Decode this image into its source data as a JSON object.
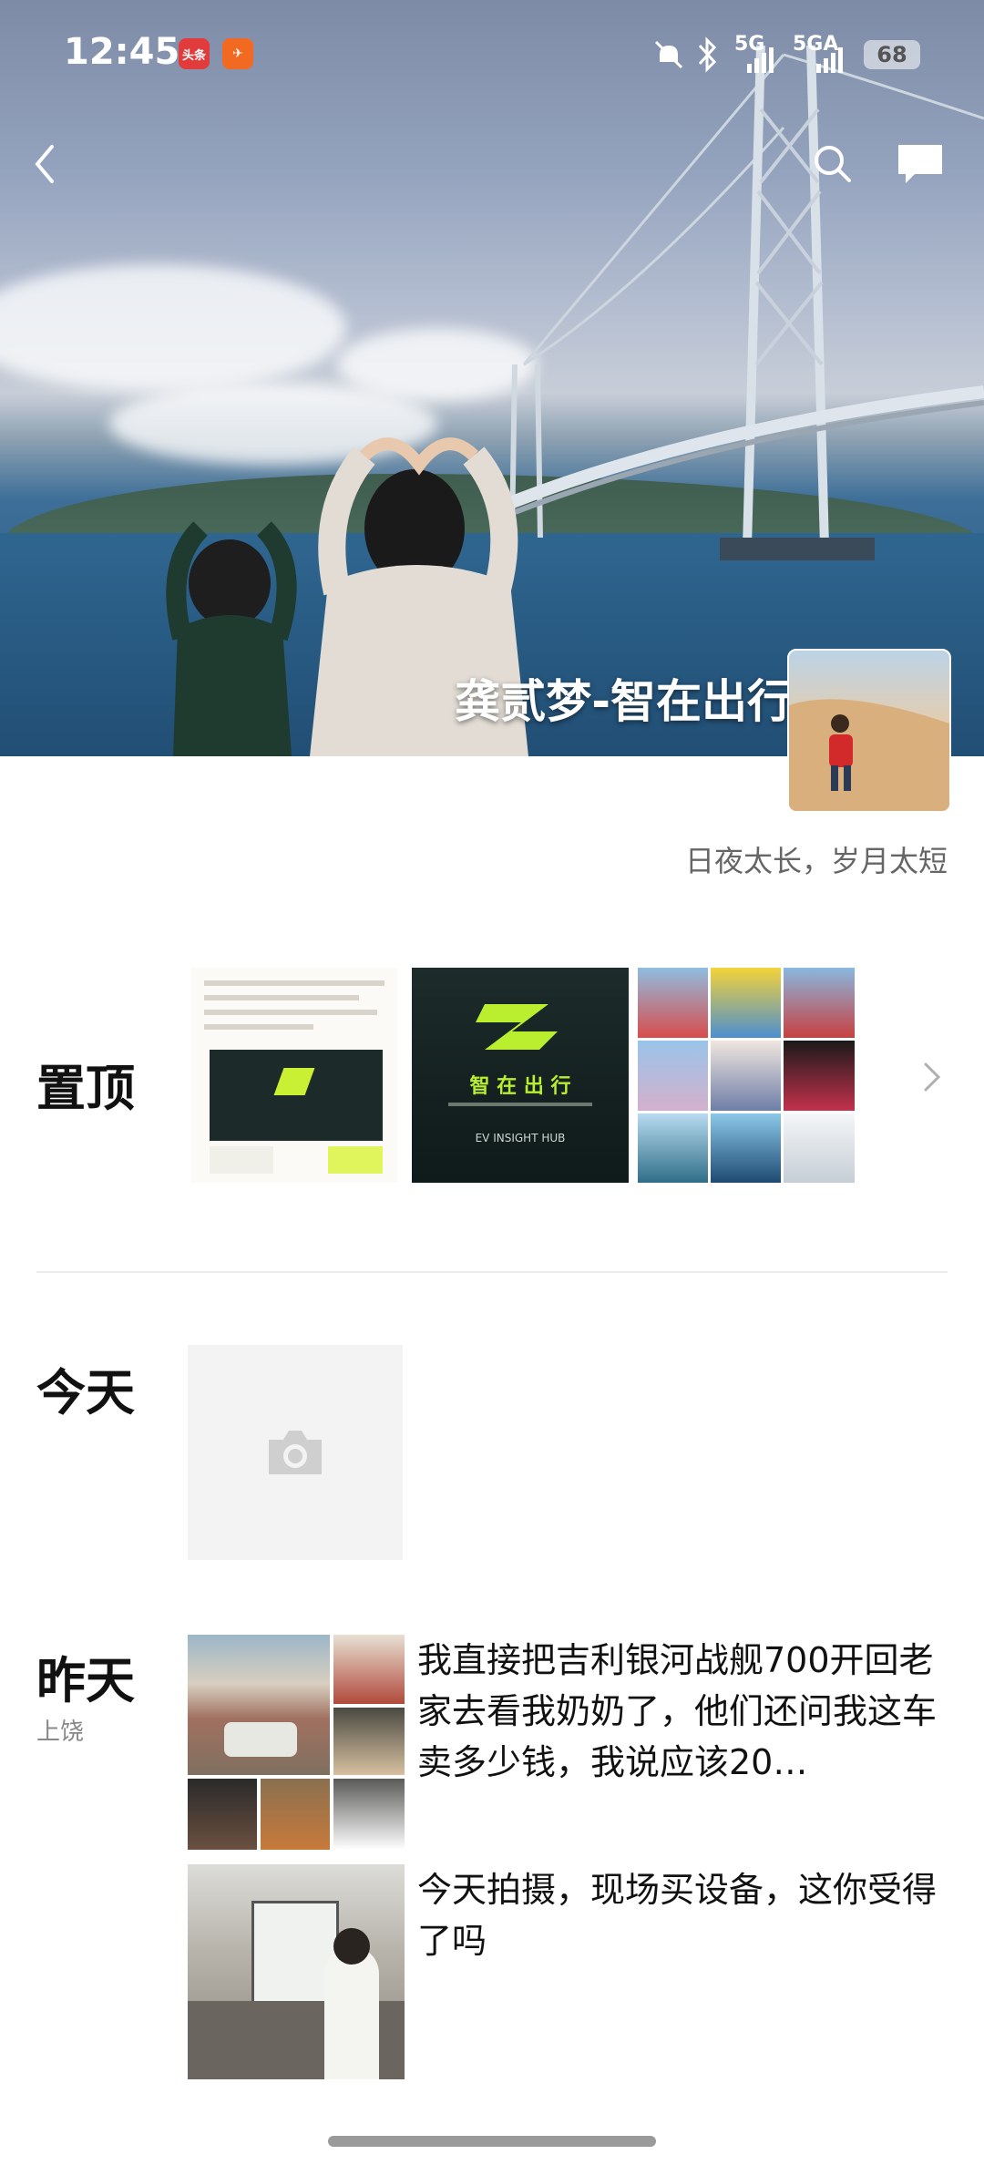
{
  "status": {
    "time": "12:45",
    "apps": [
      "头条",
      "✈"
    ],
    "net1": "5G",
    "net2": "5GA",
    "battery": "68"
  },
  "header": {
    "back_icon": "chevron-left-icon",
    "search_icon": "search-icon",
    "message_icon": "message-icon"
  },
  "profile": {
    "name": "龚贰梦-智在出行",
    "signature": "日夜太长，岁月太短"
  },
  "pinned": {
    "label": "置顶",
    "card2_title": "智 在 出 行",
    "card2_sub": "EV INSIGHT HUB"
  },
  "today": {
    "label": "今天"
  },
  "yesterday": {
    "label": "昨天",
    "location": "上饶",
    "posts": [
      {
        "text": "我直接把吉利银河战舰700开回老家去看我奶奶了，他们还问我这车卖多少钱，我说应该20…"
      },
      {
        "text": "今天拍摄，现场买设备，这你受得了吗"
      }
    ]
  }
}
